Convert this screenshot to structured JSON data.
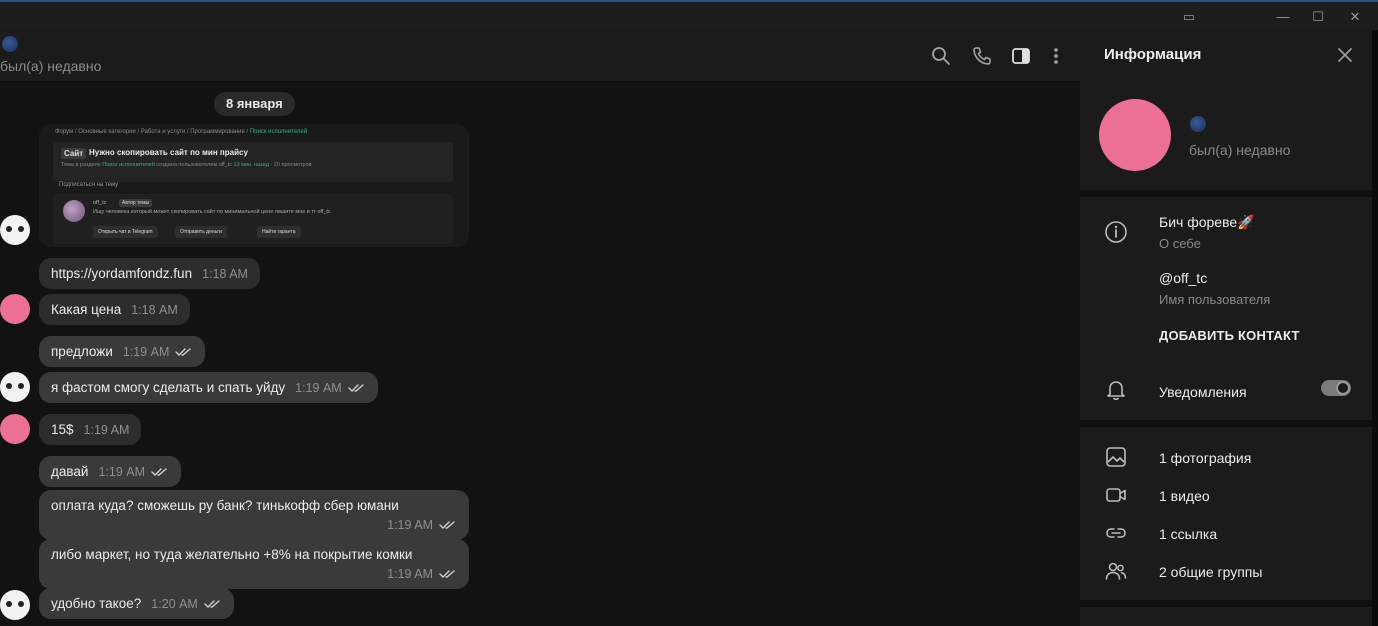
{
  "titlebar": {
    "buttons": [
      "▭",
      "—",
      "☐",
      "✕"
    ]
  },
  "chat_header": {
    "status": "был(а) недавно"
  },
  "chat": {
    "date": "8 января",
    "preview": {
      "crumbs": "Форум / Основные категории / Работа и услуги / Программирование / ",
      "crumbs_active": "Поиск исполнителей",
      "tag": "Сайт",
      "title": "Нужно скопировать сайт по мин прайсу",
      "subtitle_prefix": "Тема в разделе ",
      "subtitle_section": "Поиск исполнителей",
      "subtitle_suffix": " создана пользователем off_tc ",
      "subtitle_time": "13 мин. назад",
      "subtitle_count": " · 20 просмотров",
      "subscribe": "Подписаться на тему",
      "post_name": "off_tc",
      "post_badge": "Автор темы",
      "post_text": "Ищу человека который может скопировать сайт по минимальной цене пишите мне в тг off_tc",
      "btn1": "Открыть чат в Telegram",
      "btn2": "Отправить деньги",
      "btn3": "Найти гаранта"
    },
    "messages": [
      {
        "text": "https://yordamfondz.fun",
        "time": "1:18 AM"
      },
      {
        "text": "Какая цена",
        "time": "1:18 AM"
      },
      {
        "text": "предложи",
        "time": "1:19 AM"
      },
      {
        "text": "я фастом смогу сделать и спать уйду",
        "time": "1:19 AM"
      },
      {
        "text": "15$",
        "time": "1:19 AM"
      },
      {
        "text": "давай",
        "time": "1:19 AM"
      },
      {
        "text": "оплата куда? сможешь ру банк? тинькофф сбер юмани",
        "time": "1:19 AM"
      },
      {
        "text": "либо маркет, но туда желательно +8% на покрытие комки",
        "time": "1:19 AM"
      },
      {
        "text": "удобно такое?",
        "time": "1:20 AM"
      }
    ]
  },
  "info_panel": {
    "title": "Информация",
    "status": "был(а) недавно",
    "bio": "Бич фореве🚀",
    "bio_label": "О себе",
    "username": "@off_tc",
    "username_label": "Имя пользователя",
    "add_contact": "ДОБАВИТЬ КОНТАКТ",
    "notifications": "Уведомления",
    "notifications_on": true,
    "media": {
      "photos": "1 фотография",
      "videos": "1 видео",
      "links": "1 ссылка",
      "groups": "2 общие группы"
    }
  },
  "colors": {
    "accent_pink": "#ec6f94",
    "bubble": "#2d2d2d",
    "bubble_out": "#3a3a3a",
    "background": "#121212",
    "panel": "#1b1b1b"
  },
  "icons": [
    "search-icon",
    "phone-icon",
    "sidebar-toggle-icon",
    "more-vertical-icon",
    "close-icon",
    "info-icon",
    "bell-icon",
    "image-icon",
    "video-icon",
    "link-icon",
    "users-icon",
    "double-check-icon"
  ]
}
